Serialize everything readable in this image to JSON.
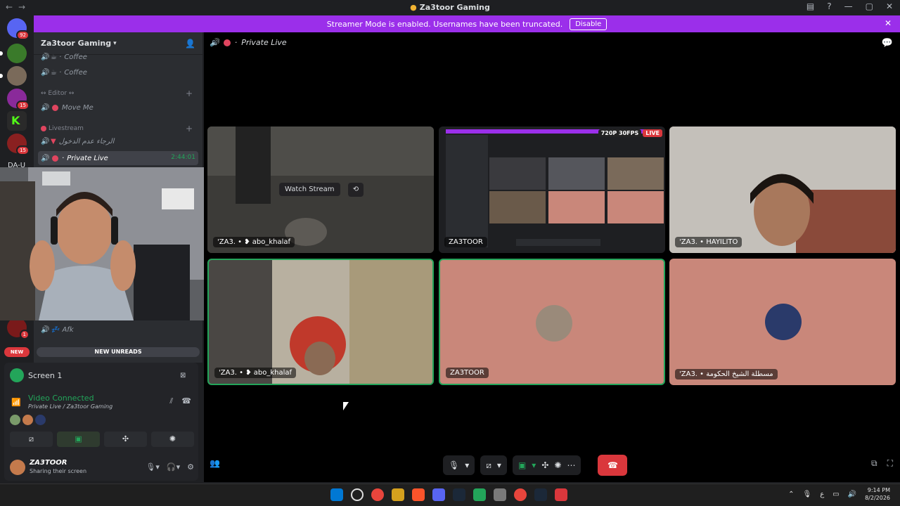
{
  "window": {
    "title": "Za3toor Gaming",
    "controls": [
      "—",
      "▢",
      "✕"
    ]
  },
  "banner": {
    "text": "Streamer Mode is enabled. Usernames have been truncated.",
    "button": "Disable"
  },
  "servers": {
    "badges": [
      "92",
      "15",
      "15",
      "1"
    ],
    "truncated_name": "DA-U"
  },
  "guild": {
    "name": "Za3toor Gaming"
  },
  "channels": [
    {
      "label": "Coffee",
      "prefix": "☕ ·"
    },
    {
      "label": "Coffee",
      "prefix": "☕ ·"
    },
    {
      "label": "Move Me",
      "prefix": ""
    },
    {
      "label": "الرجاء عدم الدخول",
      "prefix": "▼"
    },
    {
      "label": "Private Live",
      "prefix": "·",
      "timer": "2:44:01"
    },
    {
      "label": "Afk",
      "prefix": "💤"
    }
  ],
  "categories": {
    "editor": "↔ Editor ↔",
    "livestream": "Livestream"
  },
  "new_unreads": "NEW UNREADS",
  "new_pill": "NEW",
  "panel": {
    "screen_title": "Screen 1",
    "voice_status": "Video Connected",
    "voice_subtitle": "Private Live / Za3toor Gaming",
    "user_name": "ZA3TOOR",
    "user_status": "Sharing their screen"
  },
  "call": {
    "channel": "Private Live",
    "watch_stream": "Watch Stream",
    "tiles": [
      {
        "name": "'ZA3. • ❥ abo_khalaf"
      },
      {
        "name": "ZA3TOOR",
        "quality": "720P 30FPS",
        "live": "LIVE"
      },
      {
        "name": "'ZA3. • HAYILITO"
      },
      {
        "name": "'ZA3. • ❥ abo_khalaf"
      },
      {
        "name": "ZA3TOOR"
      },
      {
        "name": "'ZA3. • مسطلة الشيخ الحكومة"
      }
    ]
  },
  "clock": {
    "time": "9:14 PM",
    "date": "8/2/2026"
  },
  "colors": {
    "accent": "#9b2fea",
    "green": "#23a55a",
    "red": "#da373c",
    "tile_bg": "#c9877a"
  }
}
